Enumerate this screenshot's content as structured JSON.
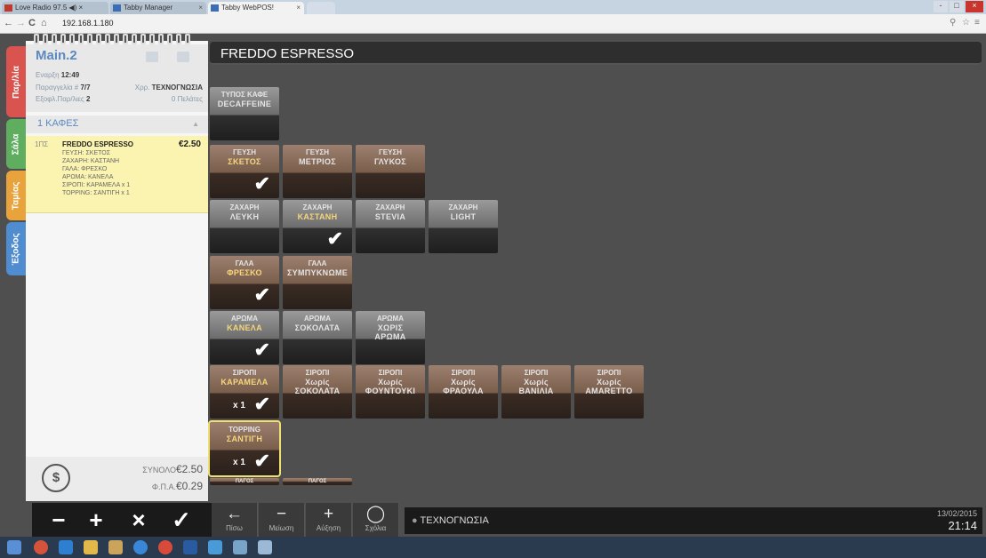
{
  "browser": {
    "tabs": [
      {
        "label": "Love Radio 97.5",
        "mute": "◀) ×"
      },
      {
        "label": "Tabby Manager"
      },
      {
        "label": "Tabby WebPOS!"
      }
    ],
    "url": "192.168.1.180",
    "window_controls": [
      "-",
      "□",
      "×"
    ]
  },
  "side_tabs": [
    {
      "label": "Παρ/λία",
      "color": "#d9534f"
    },
    {
      "label": "Σάλα",
      "color": "#5fae5f"
    },
    {
      "label": "Ταμίας",
      "color": "#e8a33c"
    },
    {
      "label": "Έξοδος",
      "color": "#4f8dd0"
    }
  ],
  "order": {
    "title": "Main.2",
    "start_label": "Εναρξη",
    "start_time": "12:49",
    "order_no_label": "Παραγγελία #",
    "order_no": "7/7",
    "user_label": "Χρρ.",
    "user": "ΤΕΧΝΟΓΝΩΣΙΑ",
    "outstanding_label": "Εξοφλ.Παρ/λιες",
    "outstanding": "2",
    "customers": "0 Πελάτες",
    "category": "1 ΚΑΦΕΣ",
    "item": {
      "qty": "1ΠΣ",
      "name": "FREDDO ESPRESSO",
      "price": "€2.50",
      "mods": [
        "ΓΕΥΣΗ: ΣΚΕΤΟΣ",
        "ΖΑΧΑΡΗ: ΚΑΣΤΑΝΗ",
        "ΓΑΛΑ: ΦΡΕΣΚΟ",
        "ΑΡΩΜΑ: ΚΑΝΕΛΑ",
        "ΣΙΡΟΠΙ: ΚΑΡΑΜΕΛΑ x 1",
        "TOPPING: ΣΑΝΤΙΓΗ x 1"
      ]
    },
    "total_label": "ΣΥΝΟΛΟ",
    "total": "€2.50",
    "vat_label": "Φ.Π.Α.",
    "vat": "€0.29"
  },
  "product_title": "FREDDO ESPRESSO",
  "tiles": {
    "coffee_type": {
      "top": "ΤΥΠΟΣ ΚΑΦΕ",
      "value": "DECAFFEINE"
    },
    "taste": [
      {
        "top": "ΓΕΥΣΗ",
        "value": "ΣΚΕΤΟΣ",
        "sel": true
      },
      {
        "top": "ΓΕΥΣΗ",
        "value": "ΜΕΤΡΙΟΣ"
      },
      {
        "top": "ΓΕΥΣΗ",
        "value": "ΓΛΥΚΟΣ"
      }
    ],
    "sugar": [
      {
        "top": "ΖΑΧΑΡΗ",
        "value": "ΛΕΥΚΗ"
      },
      {
        "top": "ΖΑΧΑΡΗ",
        "value": "ΚΑΣΤΑΝΗ",
        "sel": true
      },
      {
        "top": "ΖΑΧΑΡΗ",
        "value": "STEVIA"
      },
      {
        "top": "ΖΑΧΑΡΗ",
        "value": "LIGHT"
      }
    ],
    "milk": [
      {
        "top": "ΓΑΛΑ",
        "value": "ΦΡΕΣΚΟ",
        "sel": true
      },
      {
        "top": "ΓΑΛΑ",
        "value": "ΣΥΜΠΥΚΝΩΜΕ"
      }
    ],
    "aroma": [
      {
        "top": "ΑΡΩΜΑ",
        "value": "ΚΑΝΕΛΑ",
        "sel": true
      },
      {
        "top": "ΑΡΩΜΑ",
        "value": "ΣΟΚΟΛΑΤΑ"
      },
      {
        "top": "ΑΡΩΜΑ",
        "value": "ΧΩΡΙΣ",
        "value2": "ΑΡΩΜΑ"
      }
    ],
    "syrup": [
      {
        "top": "ΣΙΡΟΠΙ",
        "value": "ΚΑΡΑΜΕΛΑ",
        "sel": true,
        "qty": "x 1"
      },
      {
        "top": "ΣΙΡΟΠΙ",
        "value": "Χωρίς",
        "value2": "ΣΟΚΟΛΑΤΑ"
      },
      {
        "top": "ΣΙΡΟΠΙ",
        "value": "Χωρίς",
        "value2": "ΦΟΥΝΤΟΥΚΙ"
      },
      {
        "top": "ΣΙΡΟΠΙ",
        "value": "Χωρίς",
        "value2": "ΦΡΑΟΥΛΑ"
      },
      {
        "top": "ΣΙΡΟΠΙ",
        "value": "Χωρίς",
        "value2": "ΒΑΝΙΛΙΑ"
      },
      {
        "top": "ΣΙΡΟΠΙ",
        "value": "Χωρίς",
        "value2": "AMARETTO"
      }
    ],
    "topping": {
      "top": "TOPPING",
      "value": "ΣΑΝΤΙΓΗ",
      "qty": "x 1"
    },
    "ice": [
      {
        "top": "ΠΑΓΟΣ"
      },
      {
        "top": "ΠΑΓΟΣ"
      }
    ]
  },
  "bottom": {
    "actions": [
      "−",
      "+",
      "×",
      "✓"
    ],
    "nav": [
      {
        "glyph": "←",
        "label": "Πίσω"
      },
      {
        "glyph": "−",
        "label": "Μείωση"
      },
      {
        "glyph": "+",
        "label": "Αύξηση"
      },
      {
        "glyph": "◯",
        "label": "Σχόλια"
      }
    ],
    "user": "ΤΕΧΝΟΓΝΩΣΙΑ",
    "date": "13/02/2015",
    "time": "21:14"
  },
  "colors": {
    "accent": "#5a8ac0",
    "selected_text": "#f6d67a",
    "highlight": "#f0e070"
  }
}
